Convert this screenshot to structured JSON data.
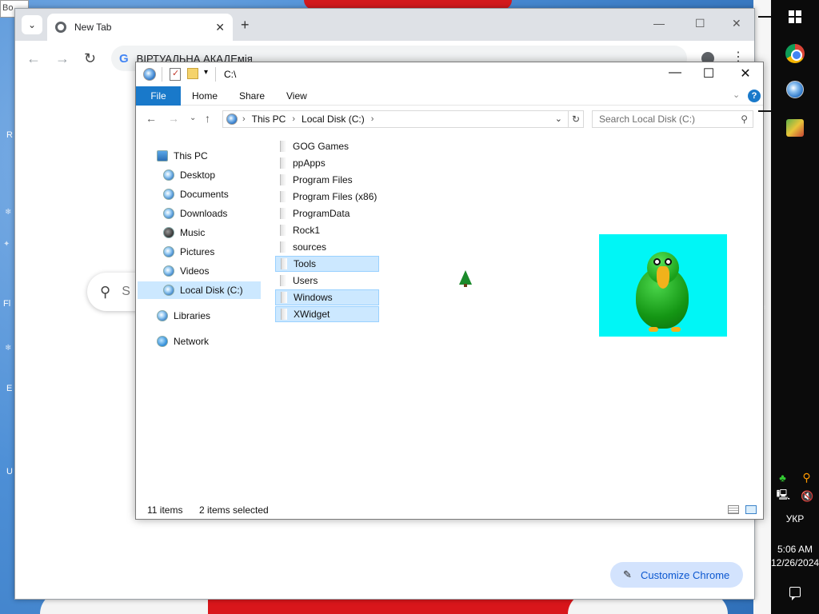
{
  "desktop": {
    "edge_text_left_top": "Bo",
    "edge_letters": [
      "R",
      "Fl",
      "E",
      "U"
    ]
  },
  "chrome": {
    "tab_title": "New Tab",
    "address_text": "ВІРТУАЛЬНА АКАДЕмія",
    "search_partial": "S",
    "customize_label": "Customize Chrome"
  },
  "explorer": {
    "title": "C:\\",
    "ribbon": {
      "file": "File",
      "home": "Home",
      "share": "Share",
      "view": "View",
      "help": "?"
    },
    "address": {
      "this_pc": "This PC",
      "local_disk": "Local Disk (C:)"
    },
    "search_placeholder": "Search Local Disk (C:)",
    "nav": {
      "this_pc": "This PC",
      "desktop": "Desktop",
      "documents": "Documents",
      "downloads": "Downloads",
      "music": "Music",
      "pictures": "Pictures",
      "videos": "Videos",
      "local_disk": "Local Disk (C:)",
      "libraries": "Libraries",
      "network": "Network"
    },
    "files": [
      {
        "name": "GOG Games",
        "selected": false
      },
      {
        "name": "ppApps",
        "selected": false
      },
      {
        "name": "Program Files",
        "selected": false
      },
      {
        "name": "Program Files (x86)",
        "selected": false
      },
      {
        "name": "ProgramData",
        "selected": false
      },
      {
        "name": "Rock1",
        "selected": false
      },
      {
        "name": "sources",
        "selected": false
      },
      {
        "name": "Tools",
        "selected": true
      },
      {
        "name": "Users",
        "selected": false
      },
      {
        "name": "Windows",
        "selected": true
      },
      {
        "name": "XWidget",
        "selected": true
      }
    ],
    "status": {
      "item_count": "11 items",
      "selected": "2 items selected"
    }
  },
  "taskbar": {
    "language": "УКР",
    "time": "5:06 AM",
    "date": "12/26/2024"
  },
  "colors": {
    "explorer_accent": "#1979ca",
    "selection": "#cce8ff",
    "preview_bg": "#00f6f6"
  }
}
